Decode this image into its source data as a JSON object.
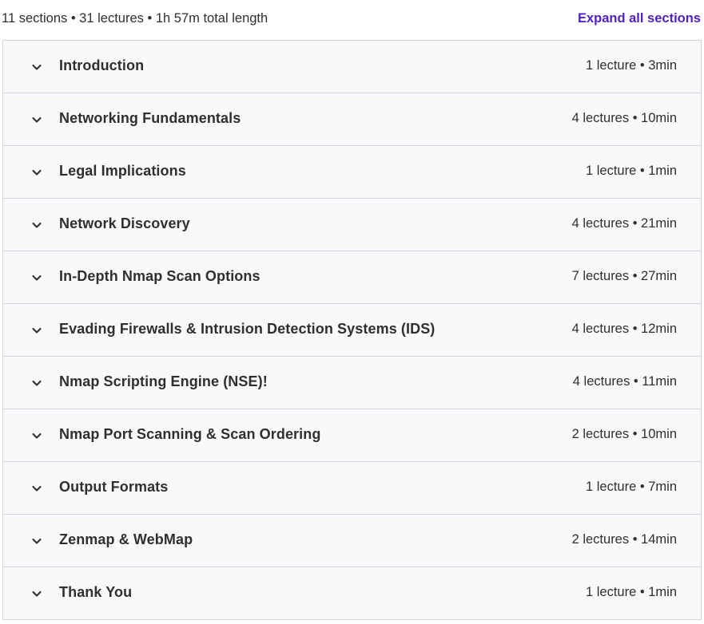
{
  "header": {
    "summary": "11 sections • 31 lectures • 1h 57m total length",
    "expand_label": "Expand all sections"
  },
  "colors": {
    "accent": "#5022c3",
    "row_background": "#f7f9fa",
    "border": "#d1d7dc",
    "text": "#2d2f31"
  },
  "icons": {
    "section_toggle": "chevron-down-icon"
  },
  "sections": [
    {
      "title": "Introduction",
      "meta": "1 lecture • 3min"
    },
    {
      "title": "Networking Fundamentals",
      "meta": "4 lectures • 10min"
    },
    {
      "title": "Legal Implications",
      "meta": "1 lecture • 1min"
    },
    {
      "title": "Network Discovery",
      "meta": "4 lectures • 21min"
    },
    {
      "title": "In-Depth Nmap Scan Options",
      "meta": "7 lectures • 27min"
    },
    {
      "title": "Evading Firewalls & Intrusion Detection Systems (IDS)",
      "meta": "4 lectures • 12min"
    },
    {
      "title": "Nmap Scripting Engine (NSE)!",
      "meta": "4 lectures • 11min"
    },
    {
      "title": "Nmap Port Scanning & Scan Ordering",
      "meta": "2 lectures • 10min"
    },
    {
      "title": "Output Formats",
      "meta": "1 lecture • 7min"
    },
    {
      "title": "Zenmap & WebMap",
      "meta": "2 lectures • 14min"
    },
    {
      "title": "Thank You",
      "meta": "1 lecture • 1min"
    }
  ]
}
